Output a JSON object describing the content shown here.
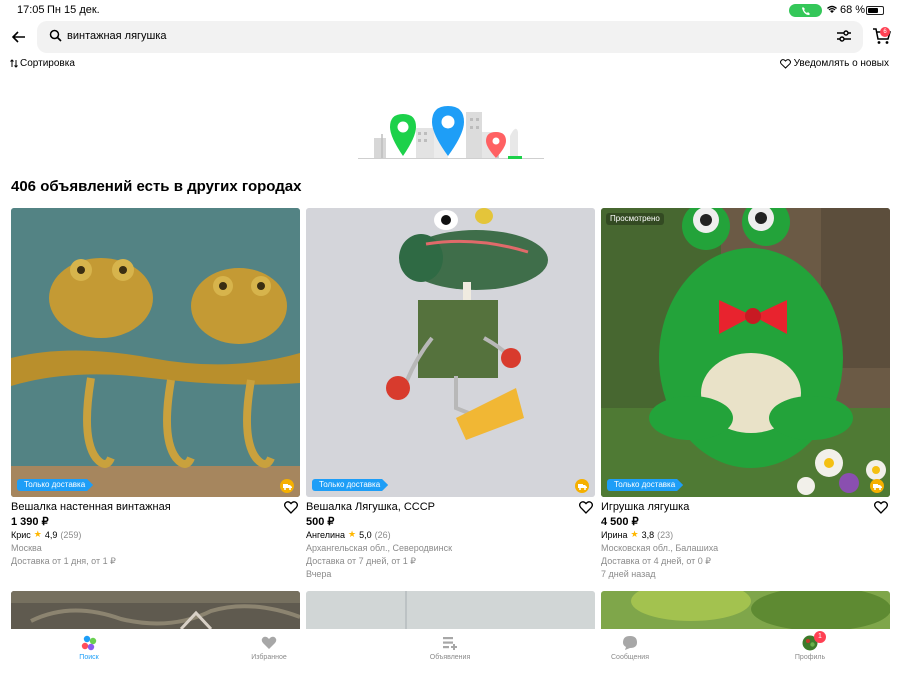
{
  "status_bar": {
    "time": "17:05",
    "date": "Пн 15 дек.",
    "battery": "68 %"
  },
  "search": {
    "query": "винтажная лягушка",
    "cart_count": "6"
  },
  "toolbar": {
    "sort_label": "Сортировка",
    "notify_label": "Уведомлять о новых"
  },
  "section_title": "406 объявлений есть в других городах",
  "listings": [
    {
      "title": "Вешалка настенная винтажная",
      "price": "1 390 ₽",
      "seller": "Крис",
      "rating": "4,9",
      "reviews": "(259)",
      "location": "Москва",
      "delivery": "Доставка от 1 дня, от 1 ₽",
      "posted": "",
      "badge": "Только доставка",
      "viewed": ""
    },
    {
      "title": "Вешалка Лягушка, СССР",
      "price": "500 ₽",
      "seller": "Ангелина",
      "rating": "5,0",
      "reviews": "(26)",
      "location": "Архангельская обл., Северодвинск",
      "delivery": "Доставка от 7 дней, от 1 ₽",
      "posted": "Вчера",
      "badge": "Только доставка",
      "viewed": ""
    },
    {
      "title": "Игрушка лягушка",
      "price": "4 500 ₽",
      "seller": "Ирина",
      "rating": "3,8",
      "reviews": "(23)",
      "location": "Московская обл., Балашиха",
      "delivery": "Доставка от 4 дней, от 0 ₽",
      "posted": "7 дней назад",
      "badge": "Только доставка",
      "viewed": "Просмотрено"
    }
  ],
  "tabs": [
    {
      "label": "Поиск",
      "icon": "search-tab-icon",
      "active": true
    },
    {
      "label": "Избранное",
      "icon": "heart-icon"
    },
    {
      "label": "Объявления",
      "icon": "listings-icon"
    },
    {
      "label": "Сообщения",
      "icon": "chat-icon"
    },
    {
      "label": "Профиль",
      "icon": "avatar-icon",
      "badge": "1"
    }
  ],
  "colors": {
    "accent": "#1e9ef7",
    "badge_red": "#ff4053",
    "star": "#ffb700",
    "muted": "#8b8b8b"
  }
}
